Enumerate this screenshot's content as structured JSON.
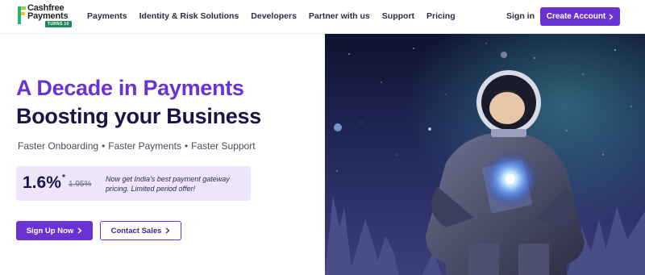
{
  "brand": {
    "name_line1": "Cashfree",
    "name_line2": "Payments",
    "badge": "TURNS 10",
    "colors": {
      "primary": "#6933d3",
      "dark": "#1b1447",
      "promo_bg": "#ede6fb"
    }
  },
  "nav": {
    "items": [
      "Payments",
      "Identity & Risk Solutions",
      "Developers",
      "Partner with us",
      "Support",
      "Pricing"
    ],
    "sign_in": "Sign in",
    "cta": "Create Account"
  },
  "hero": {
    "title_line1": "A Decade in Payments",
    "title_line2": "Boosting your Business",
    "features": [
      "Faster Onboarding",
      "Faster Payments",
      "Faster Support"
    ],
    "promo": {
      "rate": "1.6%",
      "asterisk": "*",
      "old_rate": "1.95%",
      "text": "Now get India's best payment gateway pricing. Limited period offer!"
    },
    "primary_button": "Sign Up Now",
    "secondary_button": "Contact Sales"
  },
  "image": {
    "icon": "astronaut-illustration"
  }
}
